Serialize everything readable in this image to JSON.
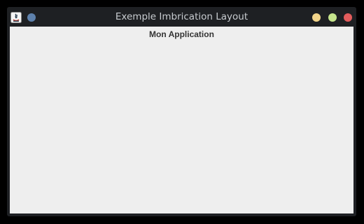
{
  "window": {
    "title": "Exemple Imbrication Layout",
    "controls": {
      "minimize_color": "#f2d48a",
      "maximize_color": "#c5e48c",
      "close_color": "#e25c5c"
    },
    "menu_dot_color": "#5e81ac"
  },
  "content": {
    "heading": "Mon Application"
  }
}
